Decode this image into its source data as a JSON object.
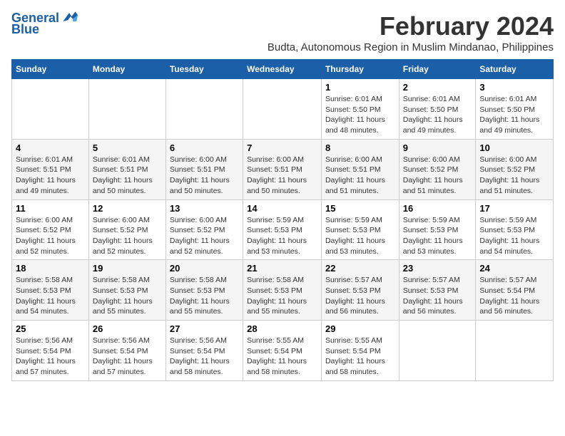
{
  "logo": {
    "line1": "General",
    "line2": "Blue"
  },
  "title": "February 2024",
  "location": "Budta, Autonomous Region in Muslim Mindanao, Philippines",
  "headers": [
    "Sunday",
    "Monday",
    "Tuesday",
    "Wednesday",
    "Thursday",
    "Friday",
    "Saturday"
  ],
  "weeks": [
    [
      {
        "day": "",
        "info": ""
      },
      {
        "day": "",
        "info": ""
      },
      {
        "day": "",
        "info": ""
      },
      {
        "day": "",
        "info": ""
      },
      {
        "day": "1",
        "info": "Sunrise: 6:01 AM\nSunset: 5:50 PM\nDaylight: 11 hours and 48 minutes."
      },
      {
        "day": "2",
        "info": "Sunrise: 6:01 AM\nSunset: 5:50 PM\nDaylight: 11 hours and 49 minutes."
      },
      {
        "day": "3",
        "info": "Sunrise: 6:01 AM\nSunset: 5:50 PM\nDaylight: 11 hours and 49 minutes."
      }
    ],
    [
      {
        "day": "4",
        "info": "Sunrise: 6:01 AM\nSunset: 5:51 PM\nDaylight: 11 hours and 49 minutes."
      },
      {
        "day": "5",
        "info": "Sunrise: 6:01 AM\nSunset: 5:51 PM\nDaylight: 11 hours and 50 minutes."
      },
      {
        "day": "6",
        "info": "Sunrise: 6:00 AM\nSunset: 5:51 PM\nDaylight: 11 hours and 50 minutes."
      },
      {
        "day": "7",
        "info": "Sunrise: 6:00 AM\nSunset: 5:51 PM\nDaylight: 11 hours and 50 minutes."
      },
      {
        "day": "8",
        "info": "Sunrise: 6:00 AM\nSunset: 5:51 PM\nDaylight: 11 hours and 51 minutes."
      },
      {
        "day": "9",
        "info": "Sunrise: 6:00 AM\nSunset: 5:52 PM\nDaylight: 11 hours and 51 minutes."
      },
      {
        "day": "10",
        "info": "Sunrise: 6:00 AM\nSunset: 5:52 PM\nDaylight: 11 hours and 51 minutes."
      }
    ],
    [
      {
        "day": "11",
        "info": "Sunrise: 6:00 AM\nSunset: 5:52 PM\nDaylight: 11 hours and 52 minutes."
      },
      {
        "day": "12",
        "info": "Sunrise: 6:00 AM\nSunset: 5:52 PM\nDaylight: 11 hours and 52 minutes."
      },
      {
        "day": "13",
        "info": "Sunrise: 6:00 AM\nSunset: 5:52 PM\nDaylight: 11 hours and 52 minutes."
      },
      {
        "day": "14",
        "info": "Sunrise: 5:59 AM\nSunset: 5:53 PM\nDaylight: 11 hours and 53 minutes."
      },
      {
        "day": "15",
        "info": "Sunrise: 5:59 AM\nSunset: 5:53 PM\nDaylight: 11 hours and 53 minutes."
      },
      {
        "day": "16",
        "info": "Sunrise: 5:59 AM\nSunset: 5:53 PM\nDaylight: 11 hours and 53 minutes."
      },
      {
        "day": "17",
        "info": "Sunrise: 5:59 AM\nSunset: 5:53 PM\nDaylight: 11 hours and 54 minutes."
      }
    ],
    [
      {
        "day": "18",
        "info": "Sunrise: 5:58 AM\nSunset: 5:53 PM\nDaylight: 11 hours and 54 minutes."
      },
      {
        "day": "19",
        "info": "Sunrise: 5:58 AM\nSunset: 5:53 PM\nDaylight: 11 hours and 55 minutes."
      },
      {
        "day": "20",
        "info": "Sunrise: 5:58 AM\nSunset: 5:53 PM\nDaylight: 11 hours and 55 minutes."
      },
      {
        "day": "21",
        "info": "Sunrise: 5:58 AM\nSunset: 5:53 PM\nDaylight: 11 hours and 55 minutes."
      },
      {
        "day": "22",
        "info": "Sunrise: 5:57 AM\nSunset: 5:53 PM\nDaylight: 11 hours and 56 minutes."
      },
      {
        "day": "23",
        "info": "Sunrise: 5:57 AM\nSunset: 5:53 PM\nDaylight: 11 hours and 56 minutes."
      },
      {
        "day": "24",
        "info": "Sunrise: 5:57 AM\nSunset: 5:54 PM\nDaylight: 11 hours and 56 minutes."
      }
    ],
    [
      {
        "day": "25",
        "info": "Sunrise: 5:56 AM\nSunset: 5:54 PM\nDaylight: 11 hours and 57 minutes."
      },
      {
        "day": "26",
        "info": "Sunrise: 5:56 AM\nSunset: 5:54 PM\nDaylight: 11 hours and 57 minutes."
      },
      {
        "day": "27",
        "info": "Sunrise: 5:56 AM\nSunset: 5:54 PM\nDaylight: 11 hours and 58 minutes."
      },
      {
        "day": "28",
        "info": "Sunrise: 5:55 AM\nSunset: 5:54 PM\nDaylight: 11 hours and 58 minutes."
      },
      {
        "day": "29",
        "info": "Sunrise: 5:55 AM\nSunset: 5:54 PM\nDaylight: 11 hours and 58 minutes."
      },
      {
        "day": "",
        "info": ""
      },
      {
        "day": "",
        "info": ""
      }
    ]
  ]
}
